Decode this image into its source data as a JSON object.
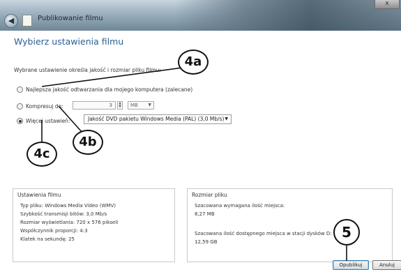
{
  "window": {
    "title": "Publikowanie filmu",
    "back_glyph": "◀",
    "close_glyph": "x"
  },
  "main": {
    "heading": "Wybierz ustawienia filmu",
    "description": "Wybrane ustawienie określa jakość i rozmiar pliku filmu:",
    "options": {
      "best": "Najlepsza jakość odtwarzania dla mojego komputera (zalecane)",
      "compress_label": "Kompresuj do:",
      "compress_value": "3",
      "compress_unit": "MB",
      "more_label": "Więcej ustawień:",
      "quality_value": "Jakość DVD pakietu Windows Media (PAL) (3,0 Mb/s)"
    },
    "selected_option": "more"
  },
  "movie_settings": {
    "title": "Ustawienia filmu",
    "lines": [
      "Typ pliku: Windows Media Video (WMV)",
      "Szybkość transmisji bitów: 3,0 Mb/s",
      "Rozmiar wyświetlania: 720 x 576 pikseli",
      "Współczynnik proporcji: 4:3",
      "Klatek na sekundę: 25"
    ]
  },
  "file_size": {
    "title": "Rozmiar pliku",
    "estimated_label": "Szacowana wymagana ilość miejsca:",
    "estimated_value": "8,27 MB",
    "available_label": "Szacowana ilość dostępnego miejsca w stacji dysków D:",
    "available_value": "12,59 GB"
  },
  "buttons": {
    "publish": "Opublikuj",
    "cancel": "Anuluj"
  },
  "callouts": {
    "c4a": "4a",
    "c4b": "4b",
    "c4c": "4c",
    "c5": "5"
  }
}
